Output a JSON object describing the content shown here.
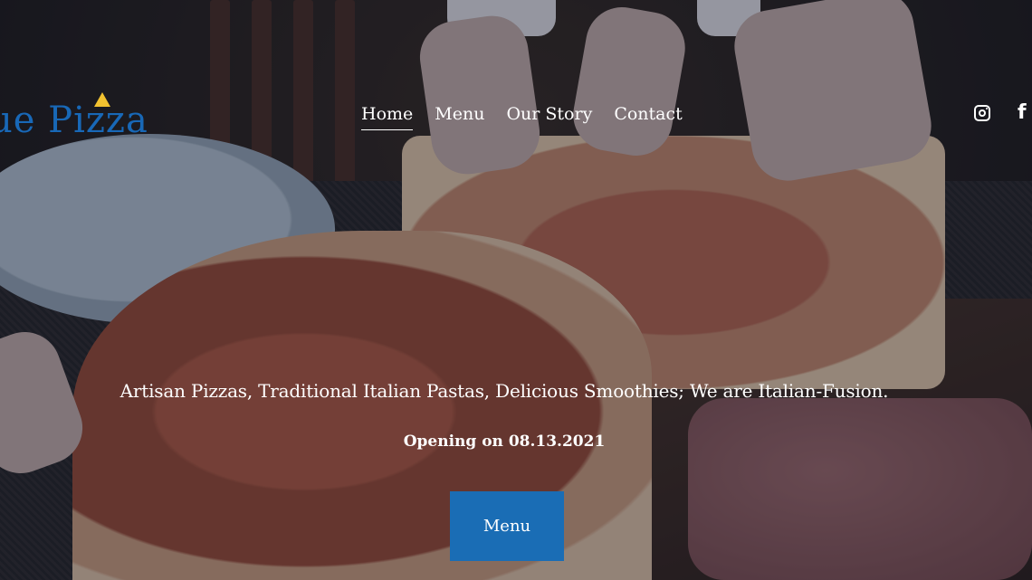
{
  "brand": {
    "logo_text": "ue Pizza",
    "logo_color": "#1868b7",
    "logo_accent_color": "#f2c230"
  },
  "nav": {
    "items": [
      {
        "label": "Home",
        "active": true
      },
      {
        "label": "Menu",
        "active": false
      },
      {
        "label": "Our Story",
        "active": false
      },
      {
        "label": "Contact",
        "active": false
      }
    ]
  },
  "social": {
    "icons": [
      "instagram-icon",
      "facebook-icon"
    ],
    "facebook_glyph": "f"
  },
  "hero": {
    "tagline": "Artisan Pizzas, Traditional Italian Pastas, Delicious Smoothies; We are Italian-Fusion.",
    "opening": "Opening on 08.13.2021",
    "cta_label": "Menu",
    "cta_color": "#1a6db5"
  }
}
